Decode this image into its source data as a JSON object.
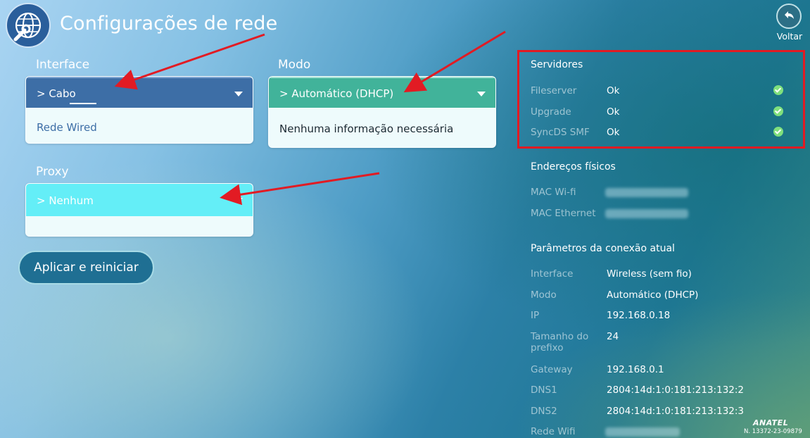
{
  "header": {
    "title": "Configurações de rede",
    "back_label": "Voltar",
    "logo_icon": "globe-wrench-icon",
    "back_icon": "back-arrow-icon"
  },
  "interface": {
    "label": "Interface",
    "selected": "> Cabo",
    "detail": "Rede Wired"
  },
  "mode": {
    "label": "Modo",
    "selected": "> Automático (DHCP)",
    "detail": "Nenhuma informação necessária"
  },
  "proxy": {
    "label": "Proxy",
    "selected": "> Nenhum"
  },
  "apply_button": "Aplicar e reiniciar",
  "servers": {
    "heading": "Servidores",
    "rows": [
      {
        "name": "Fileserver",
        "status": "Ok"
      },
      {
        "name": "Upgrade",
        "status": "Ok"
      },
      {
        "name": "SyncDS SMF",
        "status": "Ok"
      }
    ]
  },
  "physical": {
    "heading": "Endereços físicos",
    "rows": [
      {
        "name": "MAC Wi-fi"
      },
      {
        "name": "MAC Ethernet"
      }
    ]
  },
  "connection": {
    "heading": "Parâmetros da conexão atual",
    "rows": [
      {
        "name": "Interface",
        "value": "Wireless (sem fio)"
      },
      {
        "name": "Modo",
        "value": "Automático (DHCP)"
      },
      {
        "name": "IP",
        "value": "192.168.0.18"
      },
      {
        "name": "Tamanho do prefixo",
        "value": "24"
      },
      {
        "name": "Gateway",
        "value": "192.168.0.1"
      },
      {
        "name": "DNS1",
        "value": "2804:14d:1:0:181:213:132:2"
      },
      {
        "name": "DNS2",
        "value": "2804:14d:1:0:181:213:132:3"
      },
      {
        "name": "Rede Wifi"
      }
    ]
  },
  "footer": {
    "brand": "ANATEL",
    "code": "N. 13372-23-09879"
  },
  "colors": {
    "annotation_red": "#e21b23",
    "interface_header": "#3d6ea6",
    "mode_header": "#41b39a",
    "proxy_header": "#64eef7",
    "ok_green": "#7fe07d"
  }
}
